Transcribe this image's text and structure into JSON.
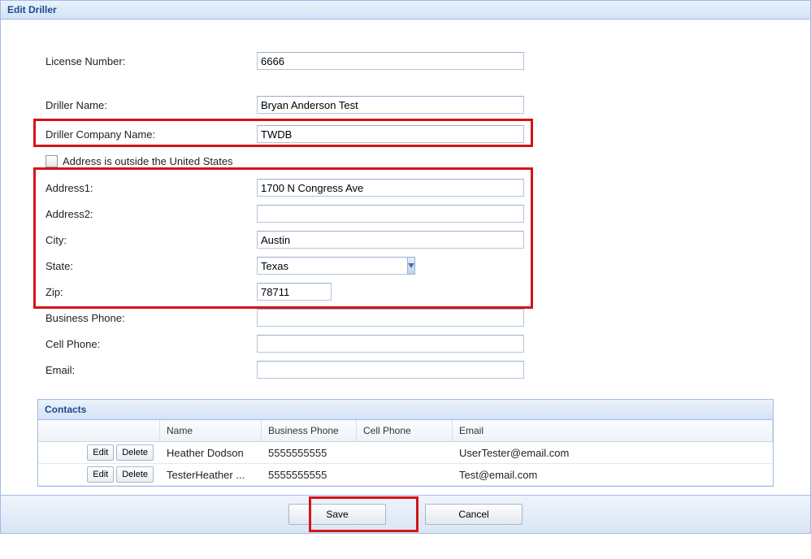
{
  "panel": {
    "title": "Edit Driller"
  },
  "form": {
    "license": {
      "label": "License Number:",
      "value": "6666"
    },
    "driller_name": {
      "label": "Driller Name:",
      "value": "Bryan Anderson Test"
    },
    "company": {
      "label": "Driller Company Name:",
      "value": "TWDB"
    },
    "outside_us": {
      "label": "Address is outside the United States",
      "checked": false
    },
    "address1": {
      "label": "Address1:",
      "value": "1700 N Congress Ave"
    },
    "address2": {
      "label": "Address2:",
      "value": ""
    },
    "city": {
      "label": "City:",
      "value": "Austin"
    },
    "state": {
      "label": "State:",
      "value": "Texas"
    },
    "zip": {
      "label": "Zip:",
      "value": "78711"
    },
    "bphone": {
      "label": "Business Phone:",
      "value": ""
    },
    "cphone": {
      "label": "Cell Phone:",
      "value": ""
    },
    "email": {
      "label": "Email:",
      "value": ""
    }
  },
  "contacts": {
    "title": "Contacts",
    "columns": {
      "name": "Name",
      "bphone": "Business Phone",
      "cphone": "Cell Phone",
      "email": "Email"
    },
    "actions": {
      "edit": "Edit",
      "delete": "Delete"
    },
    "rows": [
      {
        "name": "Heather Dodson",
        "bphone": "5555555555",
        "cphone": "",
        "email": "UserTester@email.com"
      },
      {
        "name": "TesterHeather ...",
        "bphone": "5555555555",
        "cphone": "",
        "email": "Test@email.com"
      }
    ]
  },
  "footer": {
    "save": "Save",
    "cancel": "Cancel"
  }
}
